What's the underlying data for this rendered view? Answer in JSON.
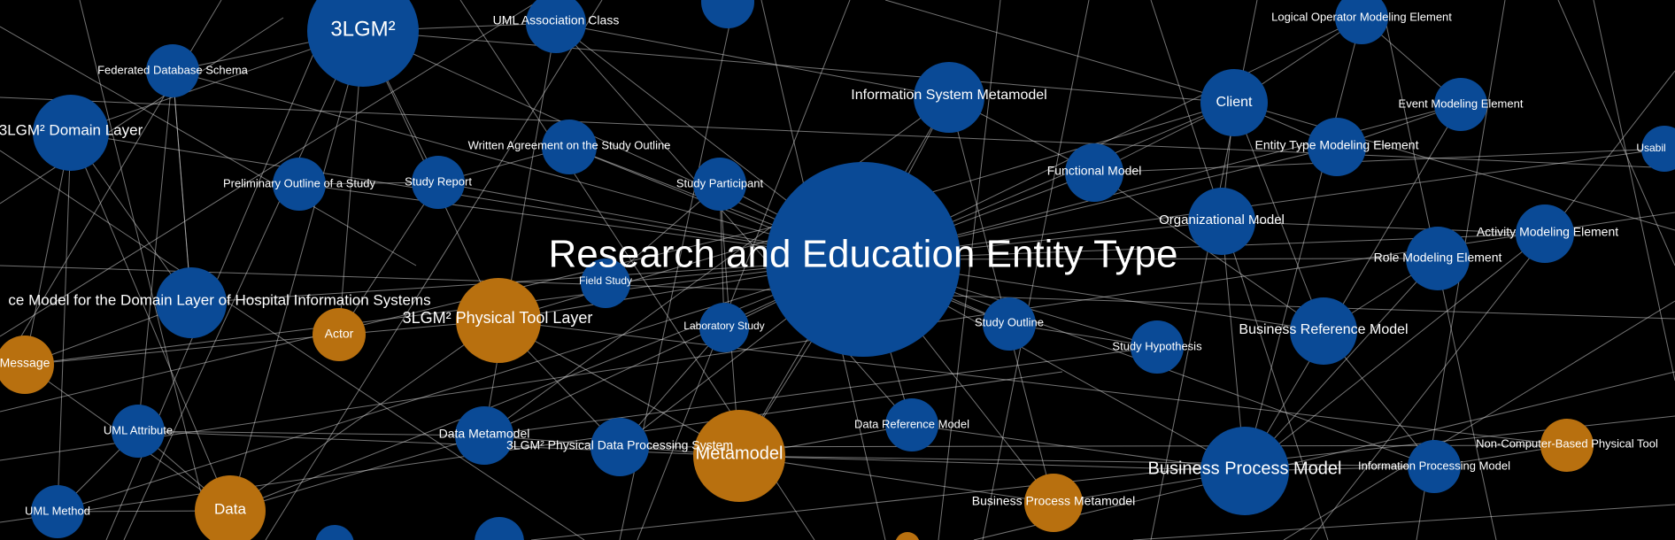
{
  "colors": {
    "background": "#000000",
    "blue_node": "#0a4a96",
    "orange_node": "#b8700f",
    "edge": "#d0d0d0",
    "label": "#ffffff"
  },
  "nodes": [
    {
      "id": "reet",
      "label": "Research and Education Entity Type",
      "type": "blue"
    },
    {
      "id": "3lgm2",
      "label": "3LGM²",
      "type": "blue"
    },
    {
      "id": "uml-assoc",
      "label": "UML Association Class",
      "type": "blue"
    },
    {
      "id": "fed-db",
      "label": "Federated Database Schema",
      "type": "blue"
    },
    {
      "id": "domain-layer",
      "label": "3LGM² Domain Layer",
      "type": "blue"
    },
    {
      "id": "written-agreement",
      "label": "Written Agreement on the Study Outline",
      "type": "blue"
    },
    {
      "id": "prelim-outline",
      "label": "Preliminary Outline of a Study",
      "type": "blue"
    },
    {
      "id": "study-report",
      "label": "Study Report",
      "type": "blue"
    },
    {
      "id": "study-participant",
      "label": "Study Participant",
      "type": "blue"
    },
    {
      "id": "is-metamodel",
      "label": "Information System Metamodel",
      "type": "blue"
    },
    {
      "id": "client",
      "label": "Client",
      "type": "blue"
    },
    {
      "id": "logical-op",
      "label": "Logical Operator Modeling Element",
      "type": "blue"
    },
    {
      "id": "event-me",
      "label": "Event Modeling Element",
      "type": "blue"
    },
    {
      "id": "entity-type-me",
      "label": "Entity Type Modeling Element",
      "type": "blue"
    },
    {
      "id": "functional-model",
      "label": "Functional Model",
      "type": "blue"
    },
    {
      "id": "org-model",
      "label": "Organizational Model",
      "type": "blue"
    },
    {
      "id": "usabil",
      "label": "Usabil",
      "type": "blue"
    },
    {
      "id": "activity-me",
      "label": "Activity Modeling Element",
      "type": "blue"
    },
    {
      "id": "role-me",
      "label": "Role Modeling Element",
      "type": "blue"
    },
    {
      "id": "ref-model-domain",
      "label": "ce Model for the Domain Layer of Hospital Information Systems",
      "type": "blue"
    },
    {
      "id": "field-study",
      "label": "Field Study",
      "type": "blue"
    },
    {
      "id": "physical-tool-layer",
      "label": "3LGM² Physical Tool Layer",
      "type": "orange"
    },
    {
      "id": "actor",
      "label": "Actor",
      "type": "orange"
    },
    {
      "id": "message",
      "label": "Message",
      "type": "orange"
    },
    {
      "id": "lab-study",
      "label": "Laboratory Study",
      "type": "blue"
    },
    {
      "id": "study-outline",
      "label": "Study Outline",
      "type": "blue"
    },
    {
      "id": "study-hypothesis",
      "label": "Study Hypothesis",
      "type": "blue"
    },
    {
      "id": "biz-ref-model",
      "label": "Business Reference Model",
      "type": "blue"
    },
    {
      "id": "uml-attr",
      "label": "UML Attribute",
      "type": "blue"
    },
    {
      "id": "data-metamodel",
      "label": "Data Metamodel",
      "type": "blue"
    },
    {
      "id": "phys-dps",
      "label": "3LGM² Physical Data Processing System",
      "type": "blue"
    },
    {
      "id": "metamodel",
      "label": "Metamodel",
      "type": "orange"
    },
    {
      "id": "data-ref-model",
      "label": "Data Reference Model",
      "type": "blue"
    },
    {
      "id": "biz-process-model",
      "label": "Business Process Model",
      "type": "blue"
    },
    {
      "id": "info-proc-model",
      "label": "Information Processing Model",
      "type": "blue"
    },
    {
      "id": "non-cbpt",
      "label": "Non-Computer-Based Physical Tool",
      "type": "orange"
    },
    {
      "id": "uml-method",
      "label": "UML Method",
      "type": "blue"
    },
    {
      "id": "data",
      "label": "Data",
      "type": "orange"
    },
    {
      "id": "bp-metamodel",
      "label": "Business Process Metamodel",
      "type": "orange"
    }
  ]
}
